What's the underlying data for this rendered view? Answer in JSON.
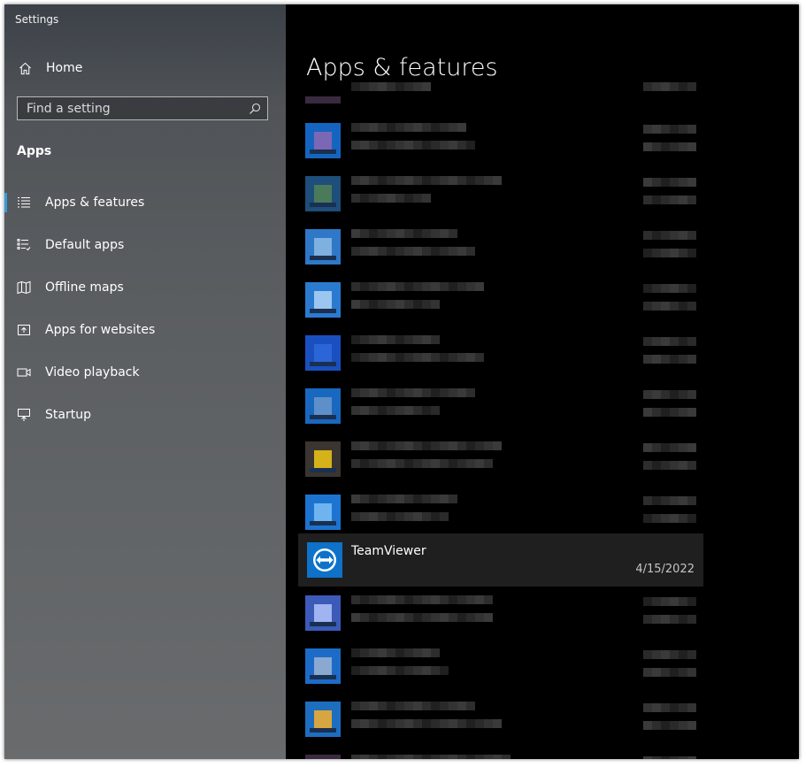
{
  "window": {
    "title": "Settings"
  },
  "sidebar": {
    "home_label": "Home",
    "search_placeholder": "Find a setting",
    "section_label": "Apps",
    "items": [
      {
        "label": "Apps & features",
        "icon": "apps-features-icon",
        "active": true
      },
      {
        "label": "Default apps",
        "icon": "default-apps-icon",
        "active": false
      },
      {
        "label": "Offline maps",
        "icon": "offline-maps-icon",
        "active": false
      },
      {
        "label": "Apps for websites",
        "icon": "apps-websites-icon",
        "active": false
      },
      {
        "label": "Video playback",
        "icon": "video-playback-icon",
        "active": false
      },
      {
        "label": "Startup",
        "icon": "startup-icon",
        "active": false
      }
    ]
  },
  "main": {
    "title": "Apps & features",
    "selected_app": {
      "name": "TeamViewer",
      "date": "4/15/2022"
    }
  },
  "colors": {
    "accent": "#3a9bdc",
    "teamviewer_blue": "#0e72c9",
    "main_background": "#000000",
    "selected_row": "#1f1f1f"
  }
}
